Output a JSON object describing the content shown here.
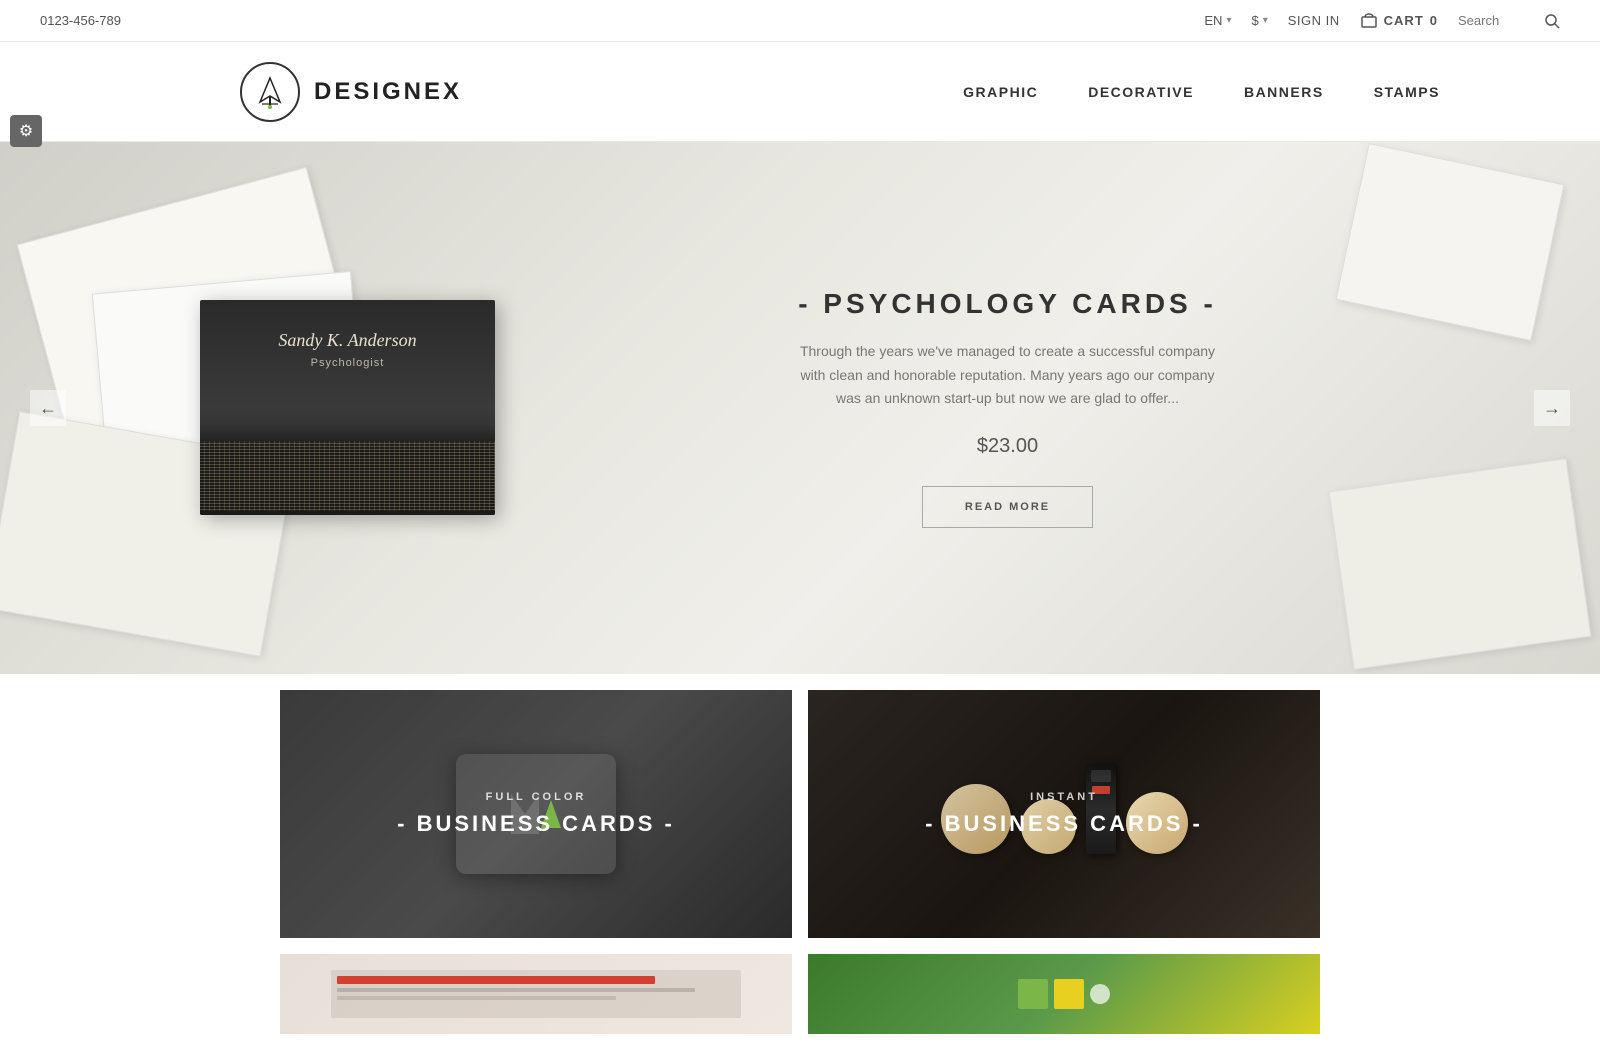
{
  "topbar": {
    "phone": "0123-456-789",
    "lang": "EN",
    "currency": "$",
    "sign_in": "SIGN IN",
    "cart": "CART",
    "cart_count": "0",
    "search_placeholder": "Search"
  },
  "header": {
    "logo_text": "DESIGNEX",
    "nav": [
      {
        "label": "GRAPHIC"
      },
      {
        "label": "DECORATIVE"
      },
      {
        "label": "BANNERS"
      },
      {
        "label": "STAMPS"
      }
    ]
  },
  "hero": {
    "prev_arrow": "←",
    "next_arrow": "→",
    "card": {
      "name": "Sandy K. Anderson",
      "title": "Psychologist"
    },
    "title": "- PSYCHOLOGY CARDS -",
    "description": "Through the years we've managed to create a successful company with clean and honorable reputation. Many years ago our company was an unknown start-up but now we are glad to offer...",
    "price": "$23.00",
    "button": "READ MORE"
  },
  "products": [
    {
      "sub": "FULL COLOR",
      "title": "- BUSINESS CARDS -",
      "theme": "dark"
    },
    {
      "sub": "INSTANT",
      "title": "- BUSINESS CARDS -",
      "theme": "food"
    }
  ],
  "bottom_products": [
    {
      "theme": "web"
    },
    {
      "theme": "color"
    }
  ],
  "gear_icon": "⚙"
}
